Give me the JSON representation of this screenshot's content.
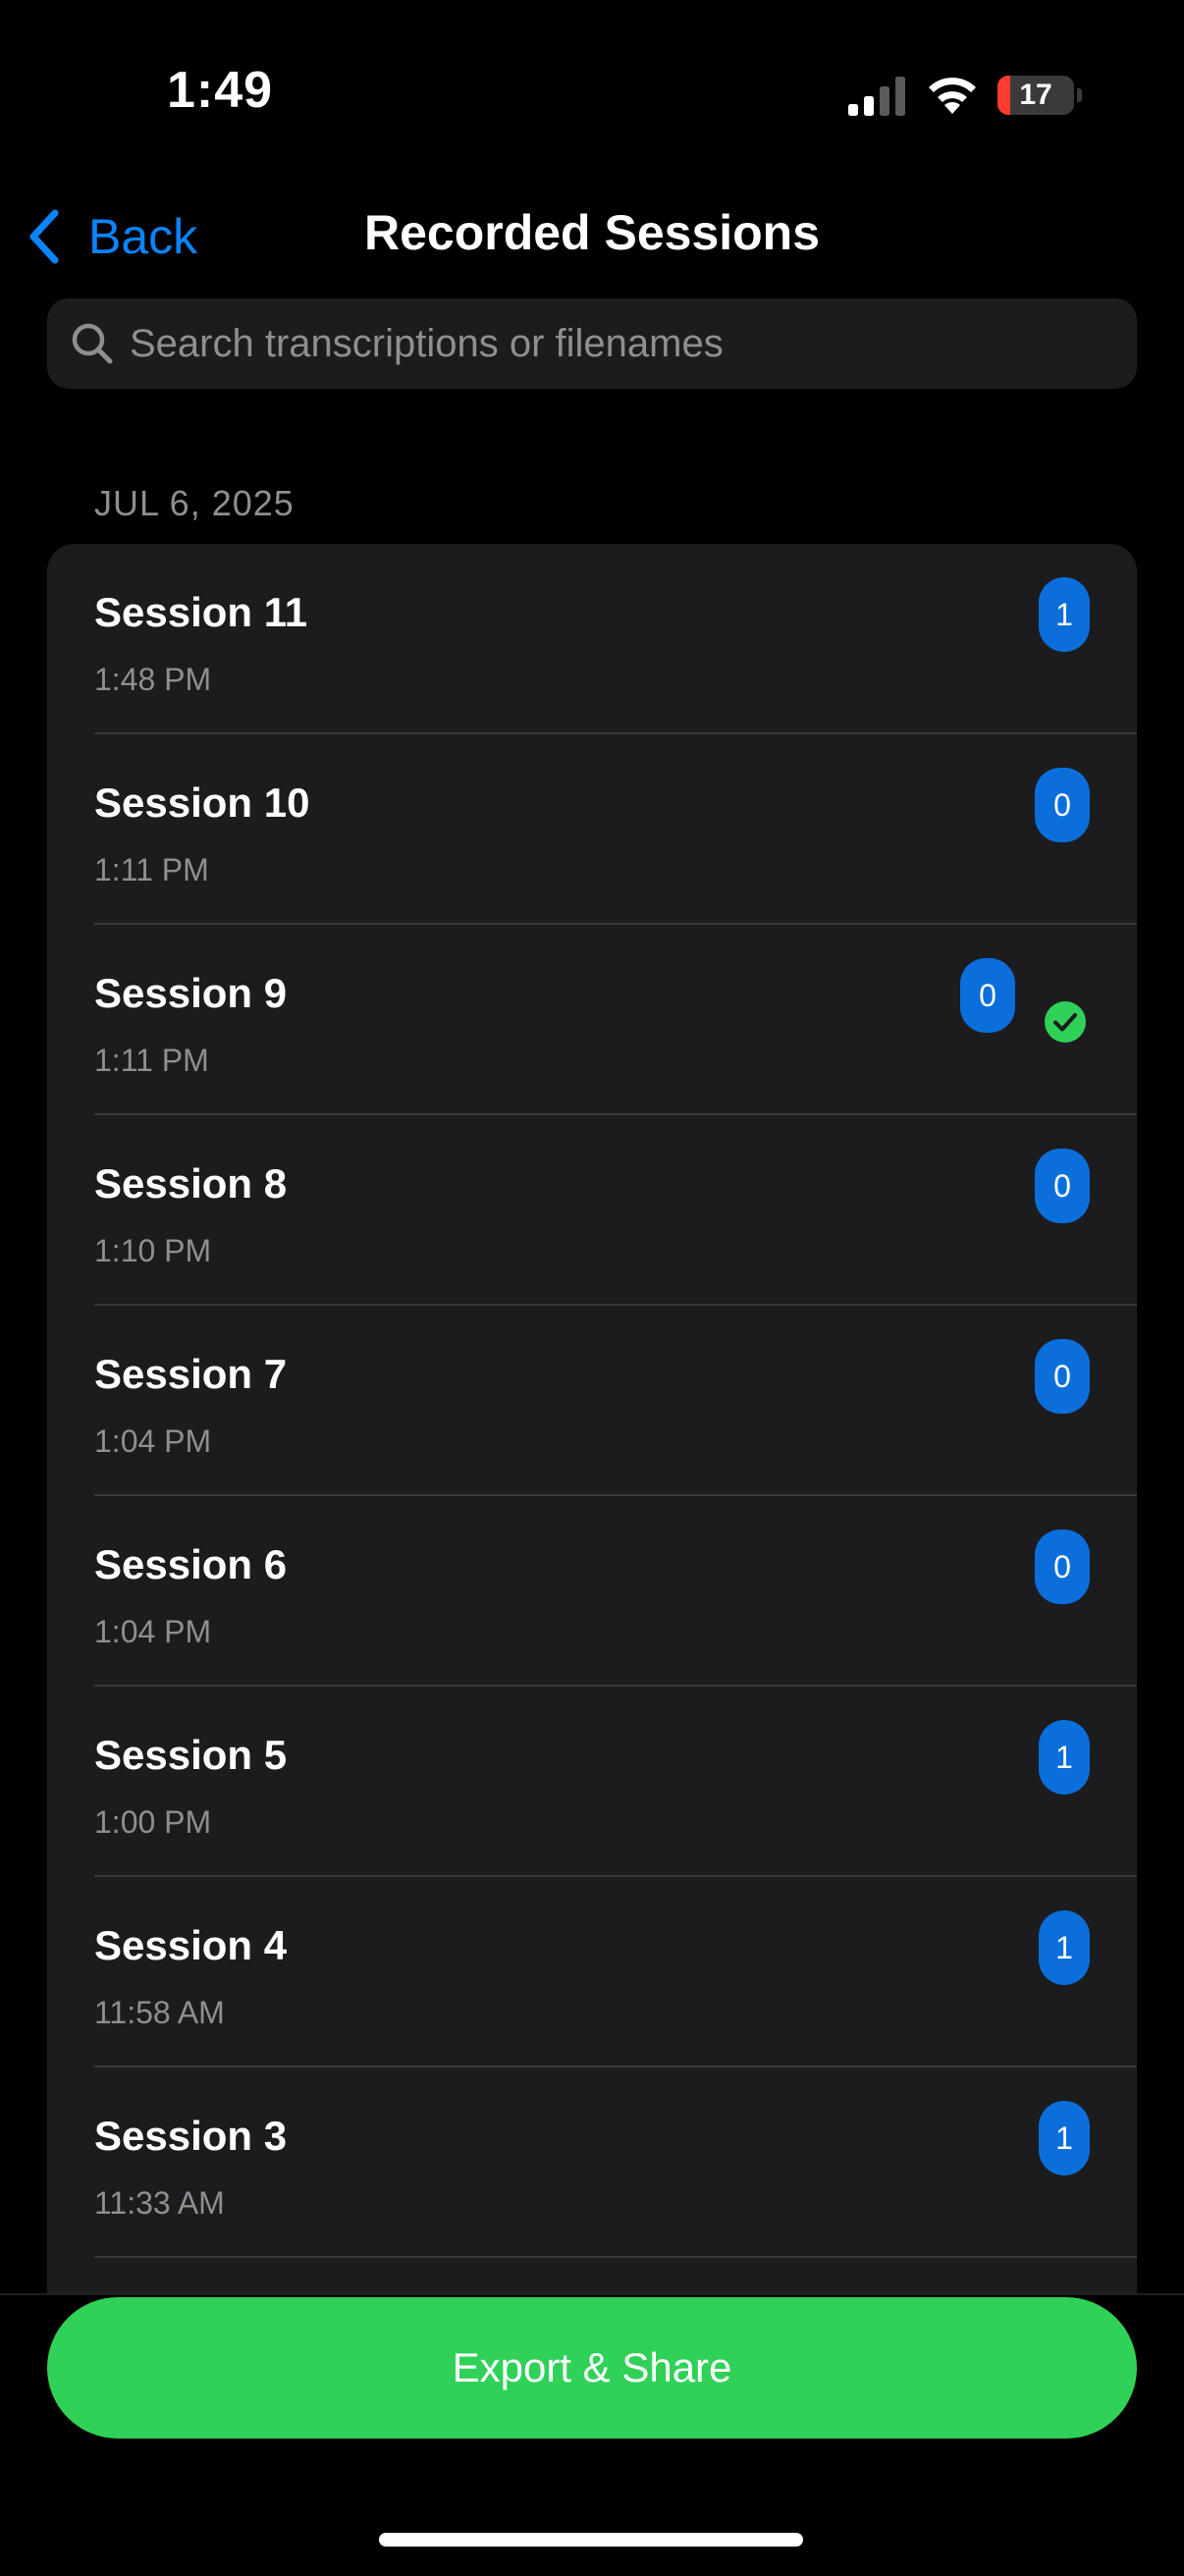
{
  "status_bar": {
    "time": "1:49",
    "battery_level": "17",
    "battery_fraction": 0.17,
    "icons": [
      "signal-icon",
      "wifi-icon",
      "battery-icon"
    ]
  },
  "nav": {
    "back_label": "Back",
    "title": "Recorded Sessions",
    "icons": [
      "chevron-left-icon"
    ]
  },
  "search": {
    "placeholder": "Search transcriptions or filenames",
    "value": "",
    "icon": "search-icon"
  },
  "section": {
    "header": "JUL 6, 2025"
  },
  "sessions": [
    {
      "title": "Session 11",
      "time": "1:48 PM",
      "count": "1",
      "checked": false
    },
    {
      "title": "Session 10",
      "time": "1:11 PM",
      "count": "0",
      "checked": false
    },
    {
      "title": "Session 9",
      "time": "1:11 PM",
      "count": "0",
      "checked": true
    },
    {
      "title": "Session 8",
      "time": "1:10 PM",
      "count": "0",
      "checked": false
    },
    {
      "title": "Session 7",
      "time": "1:04 PM",
      "count": "0",
      "checked": false
    },
    {
      "title": "Session 6",
      "time": "1:04 PM",
      "count": "0",
      "checked": false
    },
    {
      "title": "Session 5",
      "time": "1:00 PM",
      "count": "1",
      "checked": false
    },
    {
      "title": "Session 4",
      "time": "11:58 AM",
      "count": "1",
      "checked": false
    },
    {
      "title": "Session 3",
      "time": "11:33 AM",
      "count": "1",
      "checked": false
    }
  ],
  "footer": {
    "export_label": "Export & Share"
  },
  "colors": {
    "background": "#000000",
    "card": "#1c1c1e",
    "accent_blue": "#0a84ff",
    "badge_blue": "#0a6fdb",
    "success_green": "#30d158",
    "secondary_text": "#8e8e93",
    "battery_low": "#ff3b30"
  }
}
